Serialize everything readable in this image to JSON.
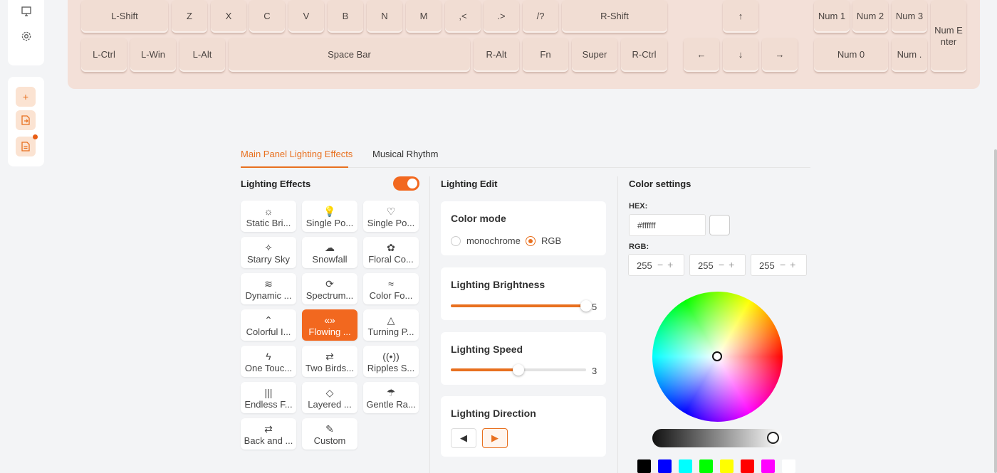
{
  "sidebar": {
    "icons": [
      "monitor-icon",
      "settings-icon"
    ],
    "actions": [
      "add-icon",
      "file-export-icon",
      "file-doc-icon"
    ]
  },
  "keyboard": {
    "rows": [
      [
        "L-Shift",
        "Z",
        "X",
        "C",
        "V",
        "B",
        "N",
        "M",
        ",<",
        ".>",
        "/?",
        "R-Shift"
      ],
      [
        "L-Ctrl",
        "L-Win",
        "L-Alt",
        "Space Bar",
        "R-Alt",
        "Fn",
        "Super",
        "R-Ctrl"
      ]
    ],
    "arrows": [
      "↑",
      "←",
      "↓",
      "→"
    ],
    "numpad": [
      "Num 1",
      "Num 2",
      "Num 3",
      "Num E nter",
      "Num 0",
      "Num ."
    ]
  },
  "tabs": [
    "Main Panel Lighting Effects",
    "Musical Rhythm"
  ],
  "effects": {
    "title": "Lighting Effects",
    "enabled": true,
    "items": [
      {
        "label": "Static Bri...",
        "icon": "☼"
      },
      {
        "label": "Single Po...",
        "icon": "💡"
      },
      {
        "label": "Single Po...",
        "icon": "♡"
      },
      {
        "label": "Starry Sky",
        "icon": "✧"
      },
      {
        "label": "Snowfall",
        "icon": "☁"
      },
      {
        "label": "Floral Co...",
        "icon": "✿"
      },
      {
        "label": "Dynamic ...",
        "icon": "≋"
      },
      {
        "label": "Spectrum...",
        "icon": "⟳"
      },
      {
        "label": "Color Fo...",
        "icon": "≈"
      },
      {
        "label": "Colorful I...",
        "icon": "⌃"
      },
      {
        "label": "Flowing ...",
        "icon": "«»"
      },
      {
        "label": "Turning P...",
        "icon": "△"
      },
      {
        "label": "One Touc...",
        "icon": "ϟ"
      },
      {
        "label": "Two Birds...",
        "icon": "⇄"
      },
      {
        "label": "Ripples S...",
        "icon": "((•))"
      },
      {
        "label": "Endless F...",
        "icon": "|||"
      },
      {
        "label": "Layered ...",
        "icon": "◇"
      },
      {
        "label": "Gentle Ra...",
        "icon": "☂"
      },
      {
        "label": "Back and ...",
        "icon": "⇄"
      },
      {
        "label": "Custom",
        "icon": "✎"
      }
    ],
    "selected": "Flowing ..."
  },
  "edit": {
    "title": "Lighting Edit",
    "color_mode": {
      "title": "Color mode",
      "options": [
        "monochrome",
        "RGB"
      ],
      "selected": "RGB"
    },
    "brightness": {
      "title": "Lighting Brightness",
      "value": "5",
      "fraction": 1.0
    },
    "speed": {
      "title": "Lighting Speed",
      "value": "3",
      "fraction": 0.5
    },
    "direction": {
      "title": "Lighting Direction",
      "left": "◀",
      "right": "▶",
      "selected": "right"
    }
  },
  "color": {
    "title": "Color settings",
    "hex_label": "HEX:",
    "hex": "#ffffff",
    "rgb_label": "RGB:",
    "r": "255",
    "g": "255",
    "b": "255",
    "pm": "−+",
    "palette": [
      "#000000",
      "#0000ff",
      "#00ffff",
      "#00ff00",
      "#ffff00",
      "#ff0000",
      "#ff00ff",
      "#ffffff"
    ],
    "accent": "#e8701f"
  }
}
